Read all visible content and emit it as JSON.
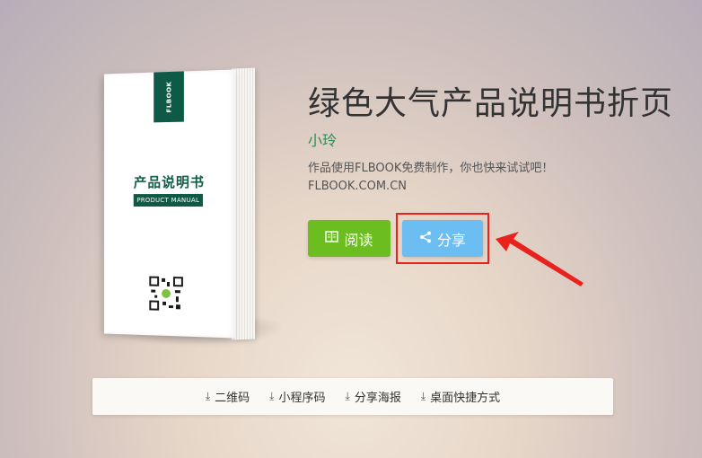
{
  "book": {
    "brand": "FLBOOK",
    "cover_title": "产品说明书",
    "cover_subtitle": "PRODUCT MANUAL"
  },
  "product": {
    "title": "绿色大气产品说明书折页",
    "author": "小玲",
    "description_line1": "作品使用FLBOOK免费制作，你也快来试试吧！",
    "description_line2": "FLBOOK.COM.CN"
  },
  "actions": {
    "read_label": "阅读",
    "share_label": "分享"
  },
  "downloads": [
    {
      "label": "二维码"
    },
    {
      "label": "小程序码"
    },
    {
      "label": "分享海报"
    },
    {
      "label": "桌面快捷方式"
    }
  ],
  "colors": {
    "read_button": "#6cbe20",
    "share_button": "#6cbdf2",
    "highlight": "#e8231e",
    "brand_green": "#0f5a46"
  }
}
